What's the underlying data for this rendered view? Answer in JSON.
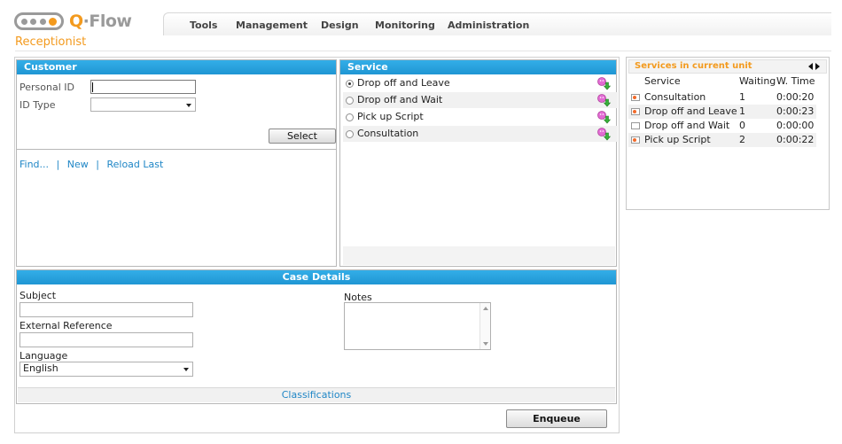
{
  "header": {
    "brand_prefix": "Q",
    "brand_suffix": "·Flow",
    "nav": [
      "Tools",
      "Management",
      "Design",
      "Monitoring",
      "Administration"
    ],
    "role": "Receptionist"
  },
  "customer": {
    "title": "Customer",
    "personal_id_label": "Personal ID",
    "personal_id_value": "",
    "id_type_label": "ID Type",
    "id_type_value": "",
    "select_button": "Select",
    "links": [
      "Find...",
      "New",
      "Reload Last"
    ],
    "separator": "|"
  },
  "service": {
    "title": "Service",
    "items": [
      {
        "label": "Drop off and Leave",
        "selected": true
      },
      {
        "label": "Drop off and Wait",
        "selected": false
      },
      {
        "label": "Pick up Script",
        "selected": false
      },
      {
        "label": "Consultation",
        "selected": false
      }
    ]
  },
  "case": {
    "title": "Case Details",
    "subject_label": "Subject",
    "external_ref_label": "External Reference",
    "language_label": "Language",
    "language_value": "English",
    "notes_label": "Notes",
    "classifications": "Classifications",
    "enqueue_button": "Enqueue"
  },
  "unit": {
    "title": "Services in current unit",
    "columns": [
      "Service",
      "Waiting",
      "W. Time"
    ],
    "rows": [
      {
        "service": "Consultation",
        "waiting": "1",
        "time": "0:00:20",
        "active": true
      },
      {
        "service": "Drop off and Leave",
        "waiting": "1",
        "time": "0:00:23",
        "active": true
      },
      {
        "service": "Drop off and Wait",
        "waiting": "0",
        "time": "0:00:00",
        "active": false
      },
      {
        "service": "Pick up Script",
        "waiting": "2",
        "time": "0:00:22",
        "active": true
      }
    ]
  },
  "colors": {
    "accent": "#1f96d3",
    "brand": "#f39a1e",
    "link": "#1f86c6"
  }
}
